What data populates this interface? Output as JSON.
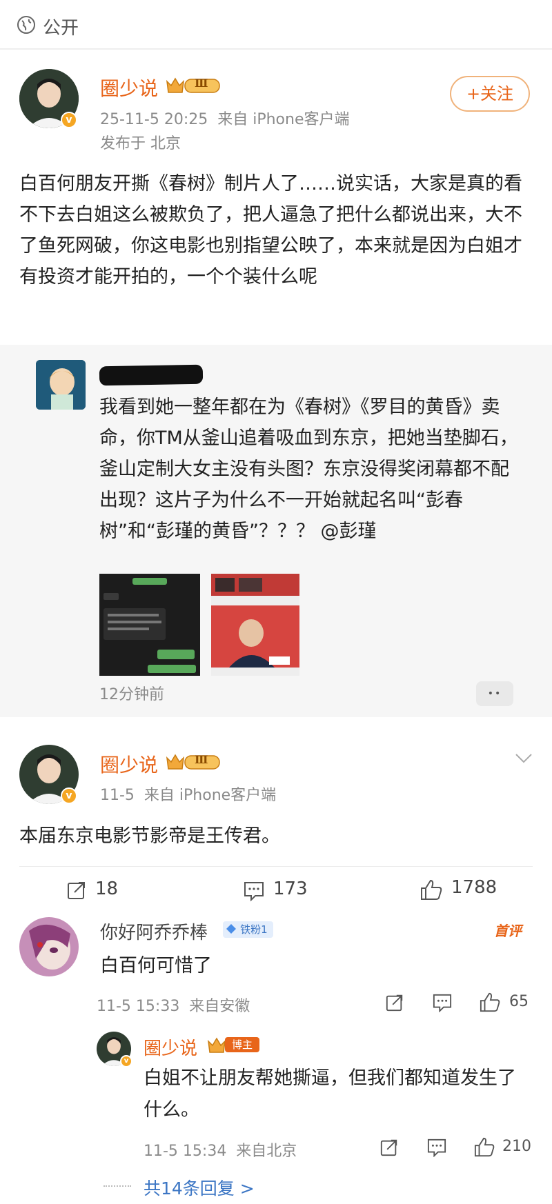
{
  "top": {
    "visibility_label": "公开"
  },
  "post": {
    "author": "圈少说",
    "level": "Ⅲ",
    "follow_label": "+关注",
    "time_source": "25-11-5 20:25  来自 iPhone客户端",
    "location": "发布于 北京",
    "text": "白百何朋友开撕《春树》制片人了……说实话，大家是真的看不下去白姐这么被欺负了，把人逼急了把什么都说出来，大不了鱼死网破，你这电影也别指望公映了，本来就是因为白姐才有投资才能开拍的，一个个装什么呢",
    "quoted": {
      "text": "我看到她一整年都在为《春树》《罗目的黄昏》卖命，你TM从釜山追着吸血到东京，把她当垫脚石，釜山定制大女主没有头图？东京没得奖闭幕都不配出现？这片子为什么不一开始就起名叫“彭春树”和“彭瑾的黄昏”？？？ @彭瑾",
      "time": "12分钟前",
      "more": "••"
    }
  },
  "comment_post": {
    "author": "圈少说",
    "level": "Ⅲ",
    "time_source": "11-5  来自 iPhone客户端",
    "text": "本届东京电影节影帝是王传君。",
    "stats": {
      "reposts": "18",
      "comments": "173",
      "likes": "1788"
    }
  },
  "comments": [
    {
      "author": "你好阿乔乔棒",
      "fan_badge": "铁粉1",
      "tag": "首评",
      "text": "白百何可惜了",
      "meta": "11-5 15:33  来自安徽",
      "likes": "65"
    }
  ],
  "reply": {
    "author": "圈少说",
    "role_badge": "博主",
    "text": "白姐不让朋友帮她撕逼，但我们都知道发生了什么。",
    "meta": "11-5 15:34  来自北京",
    "likes": "210",
    "more_replies": "共14条回复 >"
  },
  "colors": {
    "accent": "#e8651a",
    "meta_gray": "#8a8a8a",
    "link_blue": "#3c76c4"
  }
}
